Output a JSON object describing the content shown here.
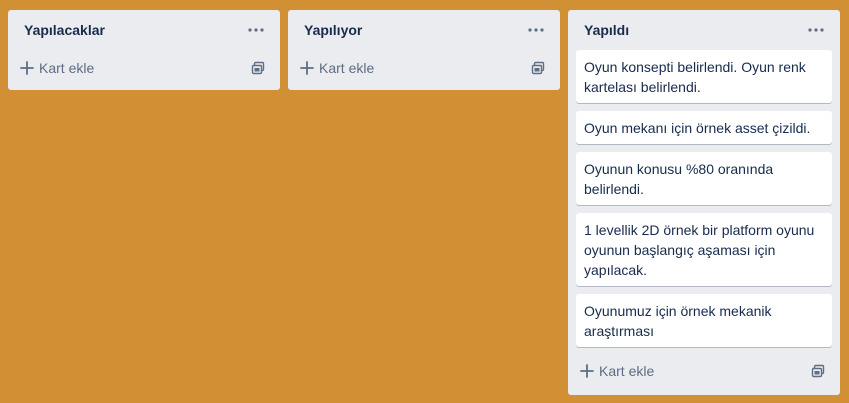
{
  "lists": [
    {
      "title": "Yapılacaklar",
      "add_card_label": "Kart ekle",
      "cards": []
    },
    {
      "title": "Yapılıyor",
      "add_card_label": "Kart ekle",
      "cards": []
    },
    {
      "title": "Yapıldı",
      "add_card_label": "Kart ekle",
      "cards": [
        "Oyun konsepti belirlendi. Oyun renk kartelası belirlendi.",
        "Oyun mekanı için örnek asset çizildi.",
        "Oyunun konusu %80 oranında belirlendi.",
        "1 levellik 2D örnek bir platform oyunu oyunun başlangıç aşaması için yapılacak.",
        "Oyunumuz için örnek mekanik araştırması"
      ]
    }
  ],
  "icons": {
    "list_menu": "more-horizontal-icon",
    "add": "plus-icon",
    "template": "card-template-icon"
  },
  "colors": {
    "board_background": "#d29034",
    "list_background": "#ebecf0",
    "card_background": "#ffffff",
    "text": "#172b4d",
    "muted_text": "#5e6c84"
  }
}
